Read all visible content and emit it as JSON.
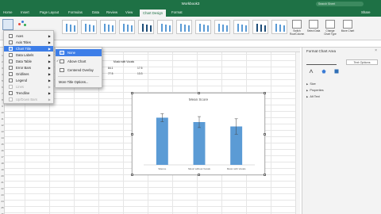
{
  "window": {
    "title": "Workbook3",
    "search_placeholder": "Search Sheet"
  },
  "ribbon_tabs": [
    "Home",
    "Insert",
    "Page Layout",
    "Formulas",
    "Data",
    "Review",
    "View",
    "Chart Design",
    "Format"
  ],
  "active_tab": "Chart Design",
  "share_label": "Share",
  "ribbon": {
    "switch_label": "Switch Row/Column",
    "select_data_label": "Select Data",
    "change_type_label": "Change Chart Type",
    "move_chart_label": "Move Chart"
  },
  "add_element_menu": {
    "items": [
      {
        "label": "Axes",
        "state": "normal"
      },
      {
        "label": "Axis Titles",
        "state": "normal"
      },
      {
        "label": "Chart Title",
        "state": "selected"
      },
      {
        "label": "Data Labels",
        "state": "normal"
      },
      {
        "label": "Data Table",
        "state": "normal"
      },
      {
        "label": "Error Bars",
        "state": "normal"
      },
      {
        "label": "Gridlines",
        "state": "normal"
      },
      {
        "label": "Legend",
        "state": "normal"
      },
      {
        "label": "Lines",
        "state": "disabled"
      },
      {
        "label": "Trendline",
        "state": "normal"
      },
      {
        "label": "Up/Down Bars",
        "state": "disabled"
      }
    ]
  },
  "chart_title_submenu": {
    "items": [
      {
        "label": "None",
        "state": "highlighted"
      },
      {
        "label": "Above Chart",
        "state": "checked"
      },
      {
        "label": "Centered Overlay",
        "state": "normal"
      }
    ],
    "more_label": "More Title Options..."
  },
  "sheet_cells": {
    "header_text": "Music with Vocals",
    "val1": "84.1",
    "val2": "17.5",
    "val3": "77.5",
    "val4": "13.3"
  },
  "row_numbers": [
    "1",
    "2",
    "3",
    "4",
    "5",
    "6",
    "7",
    "8",
    "9",
    "10",
    "11",
    "12",
    "13",
    "14",
    "15",
    "16",
    "17",
    "18",
    "19",
    "20",
    "21",
    "22",
    "23",
    "24",
    "25",
    "26"
  ],
  "chart_data": {
    "type": "bar",
    "title": "Mean Score",
    "categories": [
      "Silence",
      "Music without Vocals",
      "Music with Vocals"
    ],
    "values": [
      81.5,
      79.5,
      77.5
    ],
    "errors": [
      1.8,
      2.5,
      3.5
    ],
    "ylim": [
      60,
      86
    ],
    "bar_color": "#5b9bd5",
    "grid": false
  },
  "format_pane": {
    "title": "Format Chart Area",
    "tab_active": "",
    "tab_other": "Text Options",
    "sections": [
      "Size",
      "Properties",
      "Alt Text"
    ]
  },
  "colors": {
    "accent": "#1e7145",
    "menu_highlight": "#3d7ee8"
  }
}
